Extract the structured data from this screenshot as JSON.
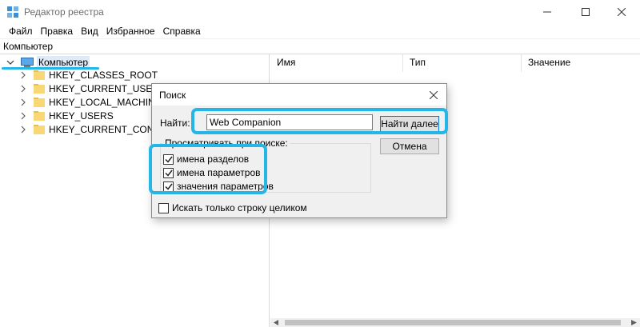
{
  "window": {
    "title": "Редактор реестра"
  },
  "menu": [
    "Файл",
    "Правка",
    "Вид",
    "Избранное",
    "Справка"
  ],
  "address": "Компьютер",
  "tree": {
    "root": "Компьютер",
    "items": [
      "HKEY_CLASSES_ROOT",
      "HKEY_CURRENT_USER",
      "HKEY_LOCAL_MACHINE",
      "HKEY_USERS",
      "HKEY_CURRENT_CONFIG"
    ]
  },
  "columns": [
    "Имя",
    "Тип",
    "Значение"
  ],
  "dialog": {
    "title": "Поиск",
    "find_label": "Найти:",
    "find_value": "Web Companion",
    "find_next": "Найти далее",
    "cancel": "Отмена",
    "group_label": "Просматривать при поиске:",
    "options": [
      {
        "label": "имена разделов",
        "checked": true
      },
      {
        "label": "имена параметров",
        "checked": true
      },
      {
        "label": "значения параметров",
        "checked": true
      }
    ],
    "whole_string": {
      "label": "Искать только строку целиком",
      "checked": false
    }
  },
  "colors": {
    "highlight": "#25b6e7",
    "selection": "#dfe9f7",
    "folder": "#f8d775"
  }
}
